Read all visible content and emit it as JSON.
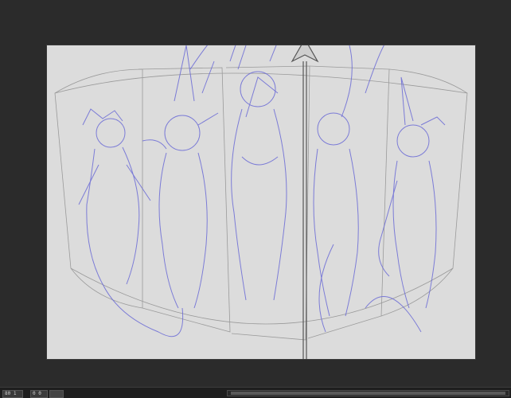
{
  "status_bar": {
    "zoom_value": "80 1",
    "rotation_value": "0 0"
  },
  "canvas": {
    "content_icon": "sketch-drawing-five-figures-with-spear"
  },
  "colors": {
    "workspace_bg": "#2b2b2b",
    "canvas_bg": "#dcdcdc",
    "sketch_stroke": "#6b6bd6",
    "guide_stroke": "#9a9a9a"
  }
}
